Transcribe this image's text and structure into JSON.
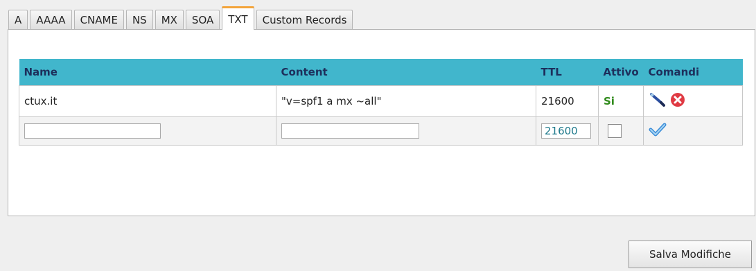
{
  "tabs": [
    {
      "label": "A"
    },
    {
      "label": "AAAA"
    },
    {
      "label": "CNAME"
    },
    {
      "label": "NS"
    },
    {
      "label": "MX"
    },
    {
      "label": "SOA"
    },
    {
      "label": "TXT",
      "active": true
    },
    {
      "label": "Custom Records"
    }
  ],
  "table": {
    "headers": {
      "name": "Name",
      "content": "Content",
      "ttl": "TTL",
      "active": "Attivo",
      "commands": "Comandi"
    },
    "rows": [
      {
        "name": "ctux.it",
        "content": "\"v=spf1 a mx ~all\"",
        "ttl": "21600",
        "active": "Si",
        "icons": [
          "edit-pencil-icon",
          "delete-icon"
        ]
      }
    ],
    "new_row": {
      "name_value": "",
      "content_value": "",
      "ttl_value": "21600",
      "active_checked": false,
      "icon": "save-checkmark-icon"
    }
  },
  "buttons": {
    "save": "Salva Modifiche"
  },
  "colors": {
    "header_bg": "#41b6cc",
    "header_text": "#1d2f5c",
    "active_tab_accent": "#f3a43a",
    "active_yes": "#2f8a1a",
    "delete_icon": "#e03a43"
  }
}
